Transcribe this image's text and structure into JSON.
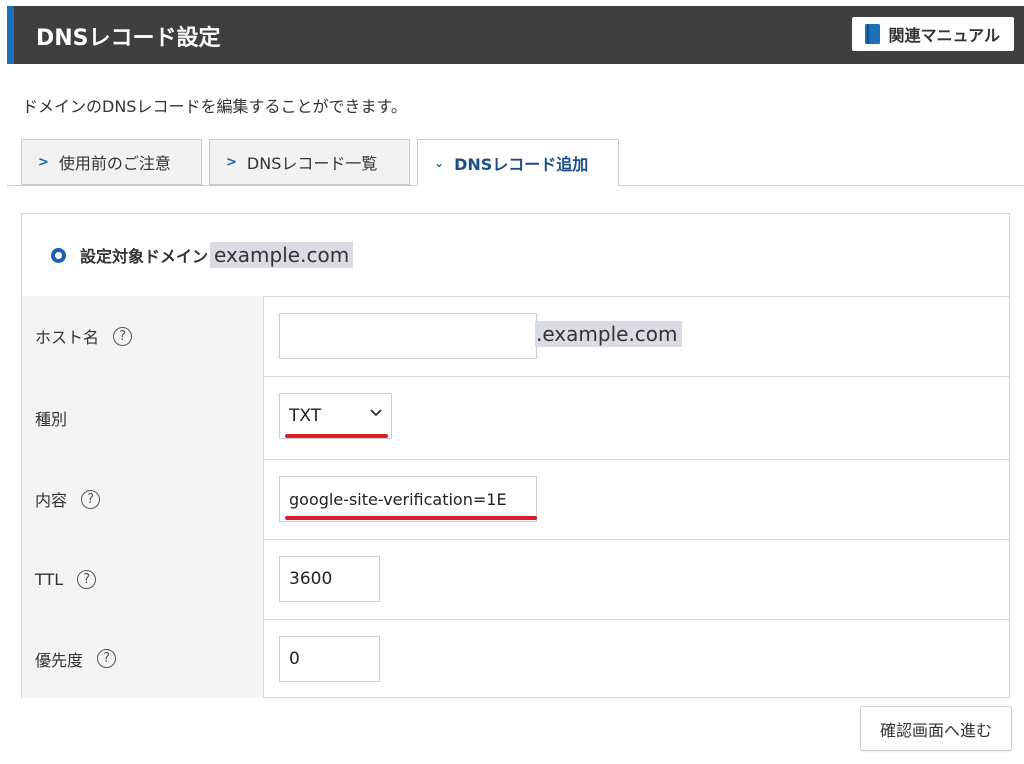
{
  "header": {
    "title": "DNSレコード設定",
    "manual_label": "関連マニュアル",
    "icon": "book-icon"
  },
  "description": "ドメインのDNSレコードを編集することができます。",
  "tabs": [
    {
      "label": "使用前のご注意",
      "active": false
    },
    {
      "label": "DNSレコード一覧",
      "active": false
    },
    {
      "label": "DNSレコード追加",
      "active": true
    }
  ],
  "form": {
    "target_label": "設定対象ドメイン",
    "target_domain": "example.com",
    "host": {
      "label": "ホスト名",
      "value": "",
      "suffix": ".example.com"
    },
    "type": {
      "label": "種別",
      "value": "TXT"
    },
    "content": {
      "label": "内容",
      "value": "google-site-verification=1E"
    },
    "ttl": {
      "label": "TTL",
      "value": "3600"
    },
    "priority": {
      "label": "優先度",
      "value": "0"
    },
    "help_glyph": "?"
  },
  "next_button": "確認画面へ進む",
  "colors": {
    "header_bg": "#3f3f3f",
    "accent": "#1d70b8",
    "highlight_red": "#d81e2a"
  }
}
